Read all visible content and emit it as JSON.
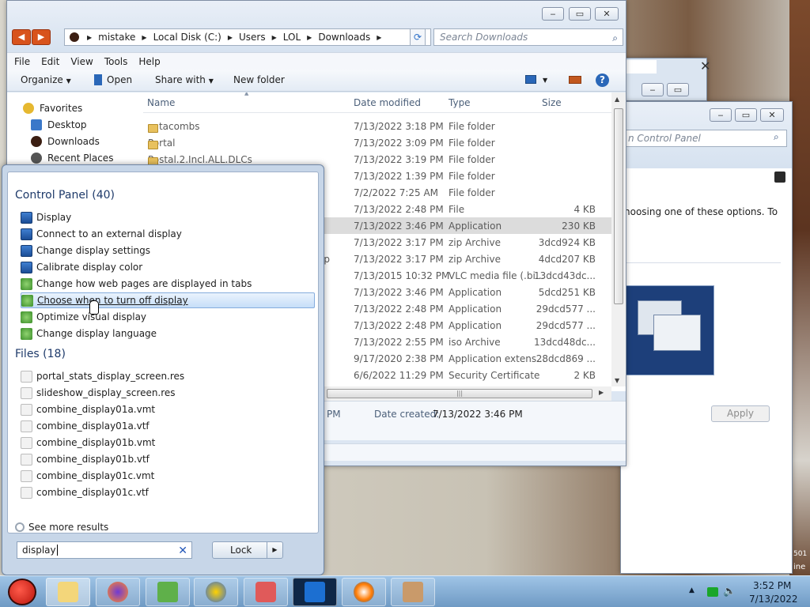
{
  "explorer": {
    "address_parts": [
      "mistake",
      "Local Disk (C:)",
      "Users",
      "LOL",
      "Downloads"
    ],
    "search_placeholder": "Search Downloads",
    "menu": [
      "File",
      "Edit",
      "View",
      "Tools",
      "Help"
    ],
    "toolbar": {
      "organize": "Organize",
      "open": "Open",
      "share_with": "Share with",
      "new_folder": "New folder"
    },
    "nav": [
      {
        "label": "Favorites",
        "icon": "star-icon"
      },
      {
        "label": "Desktop",
        "icon": "desktop-icon"
      },
      {
        "label": "Downloads",
        "icon": "downloads-icon"
      },
      {
        "label": "Recent Places",
        "icon": "recent-places-icon"
      }
    ],
    "columns": [
      "Name",
      "Date modified",
      "Type",
      "Size"
    ],
    "files": [
      {
        "name": "catacombs",
        "date": "7/13/2022 3:18 PM",
        "type": "File folder",
        "size": ""
      },
      {
        "name": "Portal",
        "date": "7/13/2022 3:09 PM",
        "type": "File folder",
        "size": ""
      },
      {
        "name": "Postal.2.Incl.ALL.DLCs",
        "date": "7/13/2022 3:19 PM",
        "type": "File folder",
        "size": ""
      },
      {
        "name": "",
        "date": "7/13/2022 1:39 PM",
        "type": "File folder",
        "size": ""
      },
      {
        "name": "",
        "date": "7/2/2022 7:25 AM",
        "type": "File folder",
        "size": ""
      },
      {
        "name": "",
        "date": "7/13/2022 2:48 PM",
        "type": "File",
        "size": "4 KB"
      },
      {
        "name": "",
        "date": "7/13/2022 3:46 PM",
        "type": "Application",
        "size": "230 KB"
      },
      {
        "name": "",
        "date": "7/13/2022 3:17 PM",
        "type": "zip Archive",
        "size": "3dcd924 KB"
      },
      {
        "name": "ip",
        "date": "7/13/2022 3:17 PM",
        "type": "zip Archive",
        "size": "4dcd207 KB"
      },
      {
        "name": "",
        "date": "7/13/2015 10:32 PM",
        "type": "VLC media file (.bi...",
        "size": "13dcd43dc..."
      },
      {
        "name": "",
        "date": "7/13/2022 3:46 PM",
        "type": "Application",
        "size": "5dcd251 KB"
      },
      {
        "name": "",
        "date": "7/13/2022 2:48 PM",
        "type": "Application",
        "size": "29dcd577 ..."
      },
      {
        "name": "",
        "date": "7/13/2022 2:48 PM",
        "type": "Application",
        "size": "29dcd577 ..."
      },
      {
        "name": "",
        "date": "7/13/2022 2:55 PM",
        "type": "iso Archive",
        "size": "13dcd48dc..."
      },
      {
        "name": "",
        "date": "9/17/2020 2:38 PM",
        "type": "Application extens...",
        "size": "28dcd869 ..."
      },
      {
        "name": "",
        "date": "6/6/2022 11:29 PM",
        "type": "Security Certificate",
        "size": "2 KB"
      }
    ],
    "details": {
      "time_fragment": "PM",
      "date_created_label": "Date created:",
      "date_created_value": "7/13/2022 3:46 PM"
    }
  },
  "control_panel": {
    "search_placeholder": "n Control Panel",
    "body_text": "noosing one of these options. To",
    "apply_label": "Apply"
  },
  "start_menu": {
    "cp_header": "Control Panel (40)",
    "cp_results": [
      "Display",
      "Connect to an external display",
      "Change display settings",
      "Calibrate display color",
      "Change how web pages are displayed in tabs",
      "Choose when to turn off display",
      "Optimize visual display",
      "Change display language"
    ],
    "files_header": "Files (18)",
    "file_results": [
      "portal_stats_display_screen.res",
      "slideshow_display_screen.res",
      "combine_display01a.vmt",
      "combine_display01a.vtf",
      "combine_display01b.vmt",
      "combine_display01b.vtf",
      "combine_display01c.vmt",
      "combine_display01c.vtf"
    ],
    "see_more": "See more results",
    "search_value": "display",
    "lock_label": "Lock"
  },
  "taskbar": {
    "time": "3:52 PM",
    "date": "7/13/2022",
    "desktop_fragments": [
      "501",
      "ine"
    ]
  },
  "colors": {
    "accent": "#2458b8",
    "highlight": "#c6def8",
    "taskbar": "#6f9ac4"
  }
}
